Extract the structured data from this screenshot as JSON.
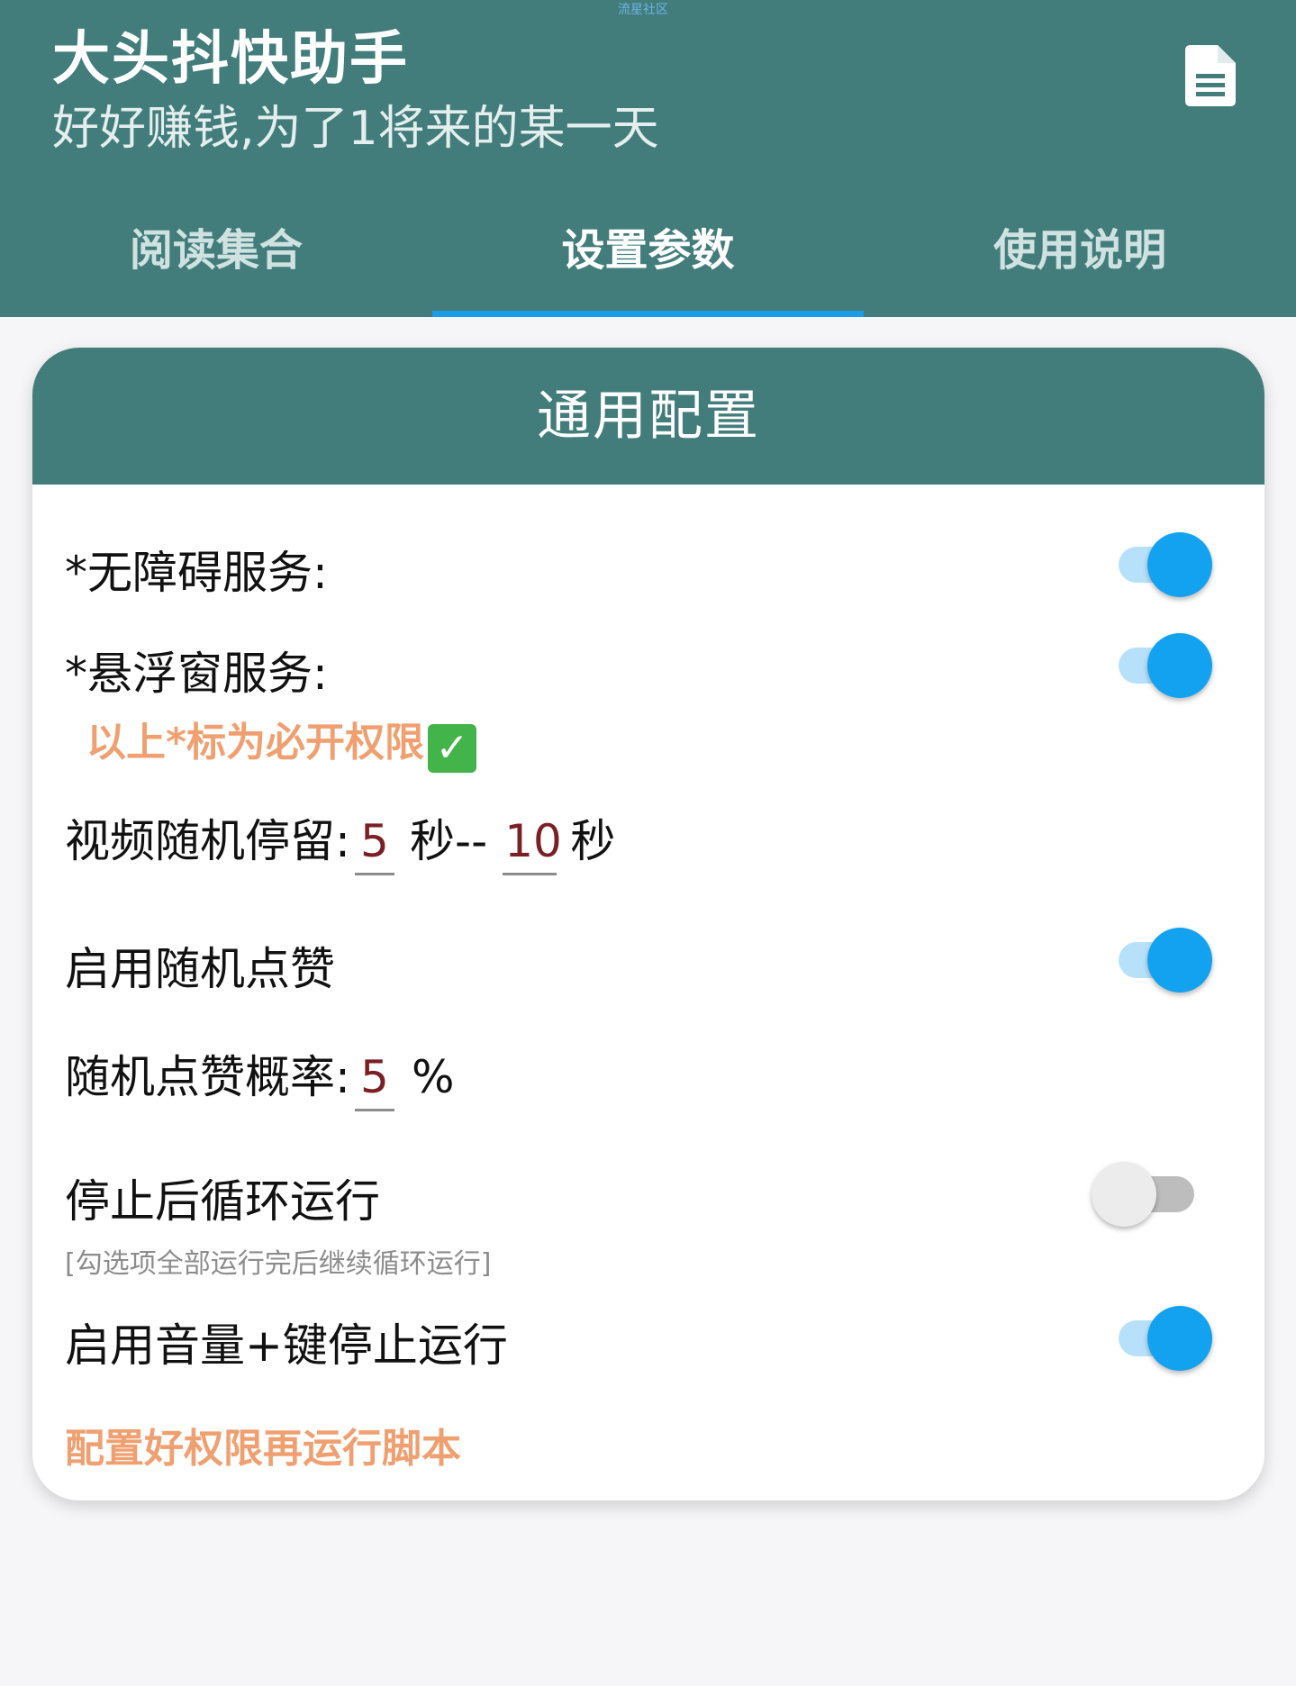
{
  "watermark": "流星社区",
  "header": {
    "title": "大头抖快助手",
    "subtitle": "好好赚钱,为了1将来的某一天",
    "doc_icon": "document-icon"
  },
  "tabs": [
    {
      "label": "阅读集合",
      "active": false
    },
    {
      "label": "设置参数",
      "active": true
    },
    {
      "label": "使用说明",
      "active": false
    }
  ],
  "card": {
    "title": "通用配置",
    "accessibility": {
      "label": "*无障碍服务:",
      "enabled": true
    },
    "floating_window": {
      "label": "*悬浮窗服务:",
      "enabled": true
    },
    "required_note": "以上*标为必开权限",
    "required_check": "✓",
    "video_stay": {
      "label": "视频随机停留:",
      "min": "5",
      "unit1": "秒--",
      "max": "10",
      "unit2": "秒"
    },
    "random_like": {
      "label": "启用随机点赞",
      "enabled": true
    },
    "like_rate": {
      "label": "随机点赞概率:",
      "value": "5",
      "unit": "%"
    },
    "loop_run": {
      "label": "停止后循环运行",
      "note": "[勾选项全部运行完后继续循环运行]",
      "enabled": false
    },
    "volume_stop": {
      "label": "启用音量+键停止运行",
      "enabled": true
    },
    "bottom_note": "配置好权限再运行脚本"
  },
  "colors": {
    "primary": "#427d7b",
    "accent": "#12a2f0",
    "tab_indicator": "#1a9ce8",
    "note_orange": "#f0a070",
    "input_value": "#7a1f26"
  }
}
